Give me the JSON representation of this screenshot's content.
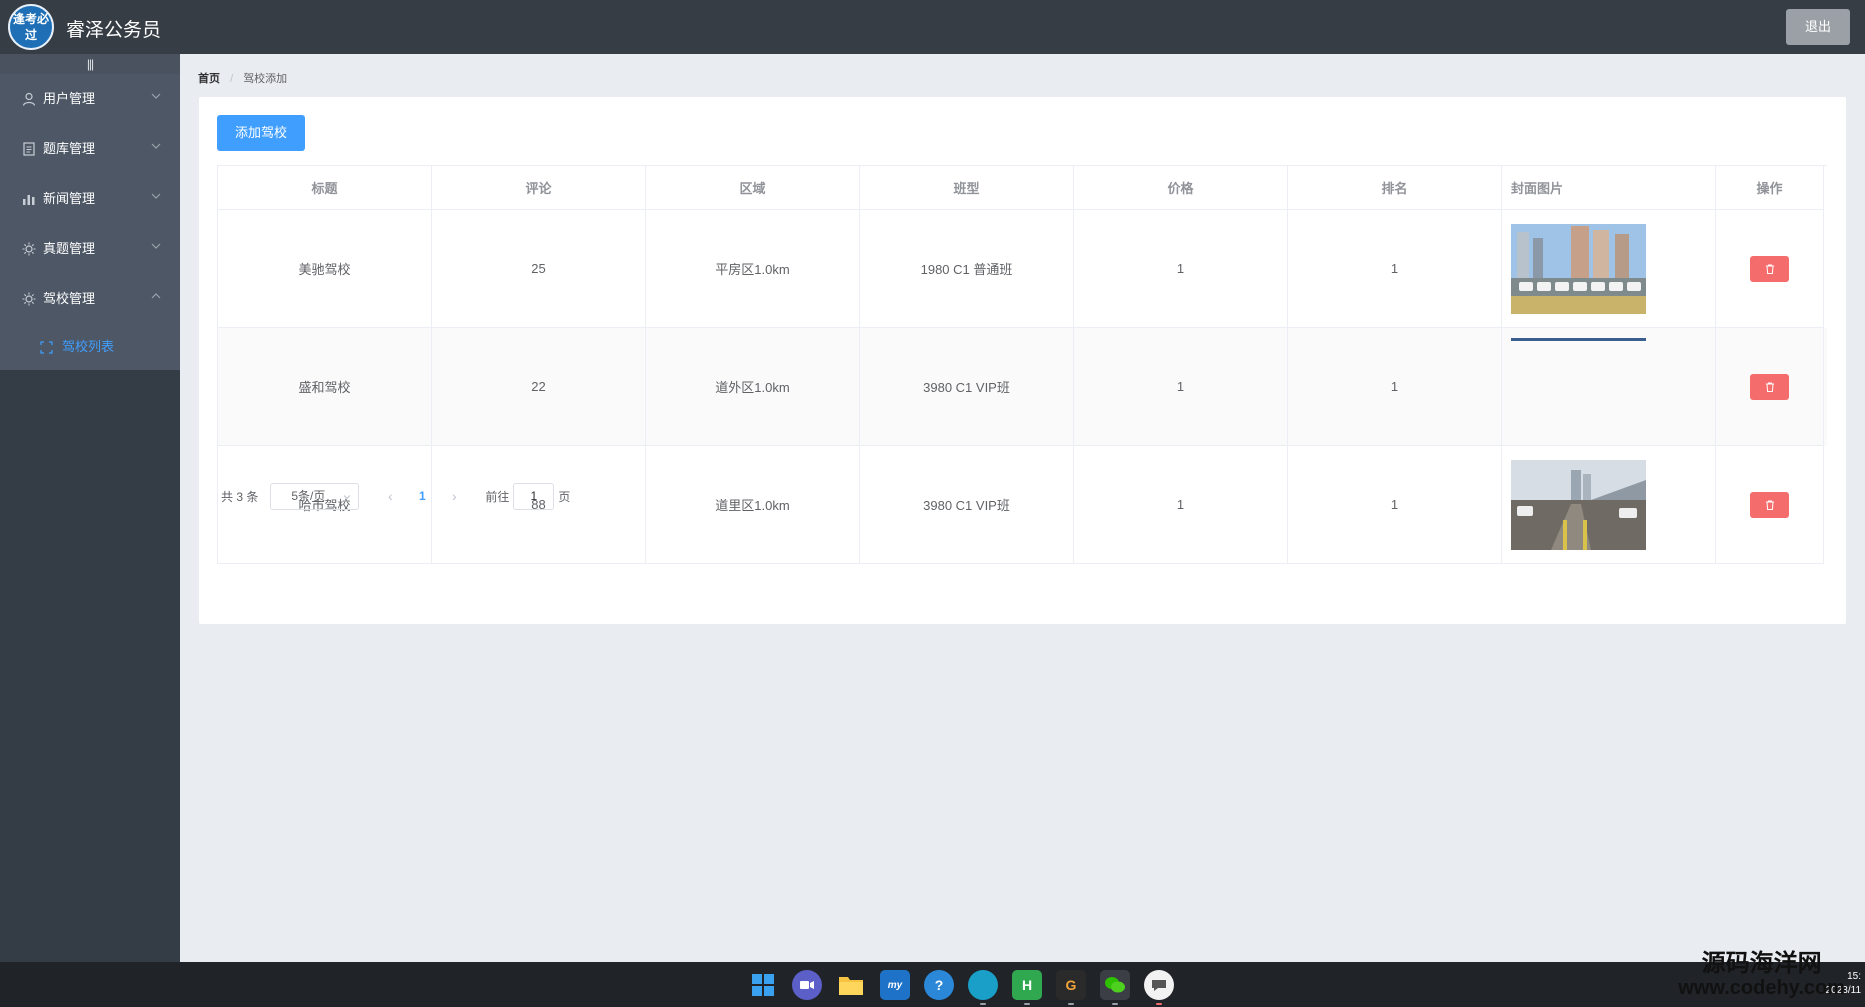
{
  "header": {
    "logo_text": "逢考必过",
    "app_title": "睿泽公务员",
    "logout_label": "退出"
  },
  "sidebar": {
    "collapse_icon": "hamburger-icon",
    "items": [
      {
        "label": "用户管理",
        "icon": "user-icon",
        "expanded": false
      },
      {
        "label": "题库管理",
        "icon": "document-icon",
        "expanded": false
      },
      {
        "label": "新闻管理",
        "icon": "bar-chart-icon",
        "expanded": false
      },
      {
        "label": "真题管理",
        "icon": "gear-icon",
        "expanded": false
      },
      {
        "label": "驾校管理",
        "icon": "gear-icon",
        "expanded": true
      }
    ],
    "submenu": [
      {
        "label": "驾校列表",
        "icon": "fullscreen-icon",
        "active": true
      }
    ]
  },
  "breadcrumb": {
    "home": "首页",
    "current": "驾校添加"
  },
  "toolbar": {
    "add_label": "添加驾校"
  },
  "table": {
    "columns": [
      "标题",
      "评论",
      "区域",
      "班型",
      "价格",
      "排名",
      "封面图片",
      "操作"
    ],
    "rows": [
      {
        "title": "美驰驾校",
        "comments": "25",
        "area": "平房区1.0km",
        "class_type": "1980 C1 普通班",
        "price": "1",
        "rank": "1",
        "cover": "parking-lot-cars"
      },
      {
        "title": "盛和驾校",
        "comments": "22",
        "area": "道外区1.0km",
        "class_type": "3980 C1 VIP班",
        "price": "1",
        "rank": "1",
        "cover": "loading-strip"
      },
      {
        "title": "哈市驾校",
        "comments": "88",
        "area": "道里区1.0km",
        "class_type": "3980 C1 VIP班",
        "price": "1",
        "rank": "1",
        "cover": "training-yard"
      }
    ],
    "delete_icon": "trash-icon"
  },
  "pagination": {
    "total": "共 3 条",
    "page_size": "5条/页",
    "current_page": "1",
    "goto_prefix": "前往",
    "goto_value": "1",
    "goto_suffix": "页"
  },
  "taskbar": {
    "time": "15:",
    "date": "2023/11"
  },
  "watermark": {
    "line1": "源码海洋网",
    "line2": "www.codehy.com"
  },
  "colors": {
    "header_bg": "#373d45",
    "sidebar_bg": "#343c46",
    "primary": "#409eff",
    "danger": "#f56c6c",
    "page_bg": "#e9ecf1"
  }
}
